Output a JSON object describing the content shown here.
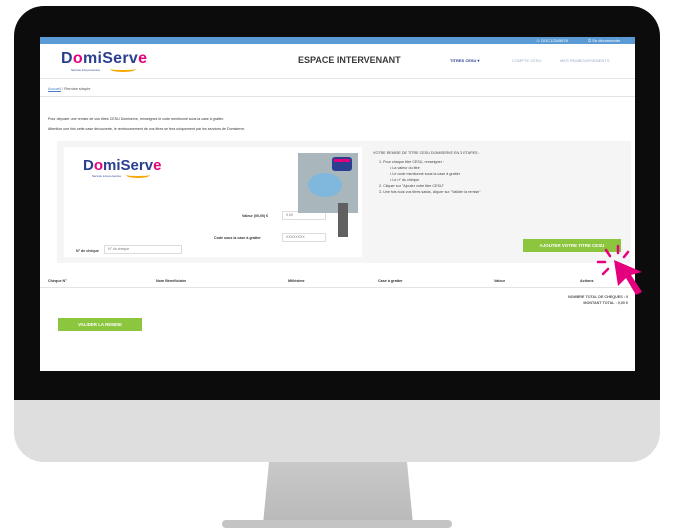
{
  "topbar": {
    "user": "DOC12345678",
    "logout": "Se déconnecter"
  },
  "header": {
    "logo_text_prefix": "D",
    "logo_text_o": "o",
    "logo_text_rest": "miServ",
    "logo_text_end": "e",
    "logo_tagline": "Service à la personne",
    "title": "ESPACE INTERVENANT",
    "nav": [
      "TITRES CESU ▾",
      "COMPTE CESU",
      "MES REMBOURSEMENTS"
    ]
  },
  "breadcrumb": {
    "home": "Accueil",
    "separator": " / ",
    "current": "Remise simple"
  },
  "intro": {
    "line1": "Pour déposer une remise de vos titres CESU Domiserve, renseignez le code mentionné sous la case à gratter.",
    "line2": "Attention une fois cette case découverte, le remboursement de vos titres se fera uniquement par les services de Domiserve."
  },
  "form": {
    "valeur_label": "Valeur (00,00) €",
    "valeur_placeholder": "0,00",
    "code_label": "Code sous la case à gratter",
    "code_placeholder": "XXXXXXXX",
    "cheque_label": "N° de chèque",
    "cheque_placeholder": "N° du chèque"
  },
  "instructions": {
    "title": "VOTRE REMISE DE TITRE CESU DOMISERVE EN 3 ETAPES :",
    "step1": "1. Pour chaque titre CESU, renseigner :",
    "bullets": [
      "La valeur du titre",
      "Le code mentionné sous la case à gratter",
      "Le n° du chèque"
    ],
    "step2": "2. Cliquer sur \"Ajouter votre titre CESU\"",
    "step3": "3. Une fois tous vos titres saisis, cliquer sur \"Valider la remise\""
  },
  "add_button": "AJOUTER VOTRE TITRE CESU",
  "table": {
    "headers": [
      "Chèque N°",
      "Nom Bénéficiaire",
      "Millésime",
      "Case à gratter",
      "Valeur",
      "Actions"
    ]
  },
  "totals": {
    "count": "NOMBRE TOTAL DE CHEQUES : 0",
    "amount": "MONTANT TOTAL : 0,00 €"
  },
  "validate_button": "VALIDER LA REMISE",
  "colors": {
    "brand_blue": "#2a3f8f",
    "brand_pink": "#e5007d",
    "accent_green": "#8cc63f",
    "top_strip": "#5b9bd5"
  }
}
